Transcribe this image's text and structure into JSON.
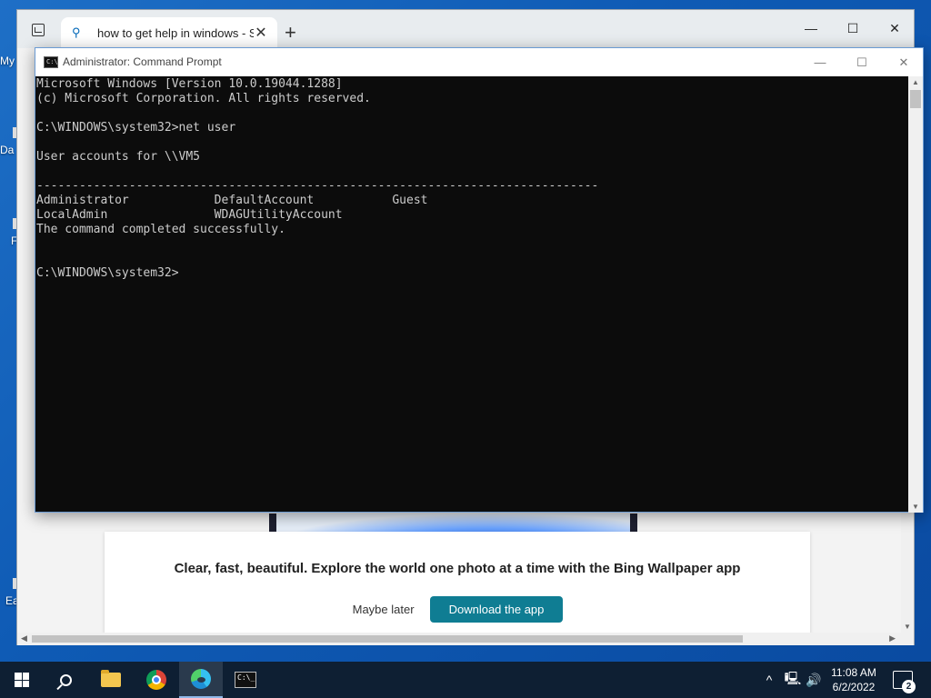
{
  "desktop": {
    "fragments": [
      "My",
      "Da",
      "F",
      "Ea"
    ]
  },
  "browser": {
    "tab_title": "how to get help in windows - Se",
    "tab_close": "✕",
    "new_tab": "+",
    "minimize": "—",
    "maximize": "☐",
    "close": "✕",
    "promo_text": "Clear, fast, beautiful. Explore the world one photo at a time with the Bing Wallpaper app",
    "maybe_later": "Maybe later",
    "download_app": "Download the app"
  },
  "cmd": {
    "title": "Administrator: Command Prompt",
    "icon_text": "C:\\",
    "minimize": "—",
    "maximize": "☐",
    "close": "✕",
    "lines": [
      "Microsoft Windows [Version 10.0.19044.1288]",
      "(c) Microsoft Corporation. All rights reserved.",
      "",
      "C:\\WINDOWS\\system32>net user",
      "",
      "User accounts for \\\\VM5",
      "",
      "-------------------------------------------------------------------------------",
      "Administrator            DefaultAccount           Guest",
      "LocalAdmin               WDAGUtilityAccount",
      "The command completed successfully.",
      "",
      "",
      "C:\\WINDOWS\\system32>"
    ]
  },
  "taskbar": {
    "apps": [
      "start-button",
      "search-button",
      "file-explorer",
      "chrome",
      "edge",
      "command-prompt"
    ],
    "active_app": "edge",
    "tray_chevron": "^",
    "time": "11:08 AM",
    "date": "6/2/2022",
    "notification_count": "2"
  }
}
